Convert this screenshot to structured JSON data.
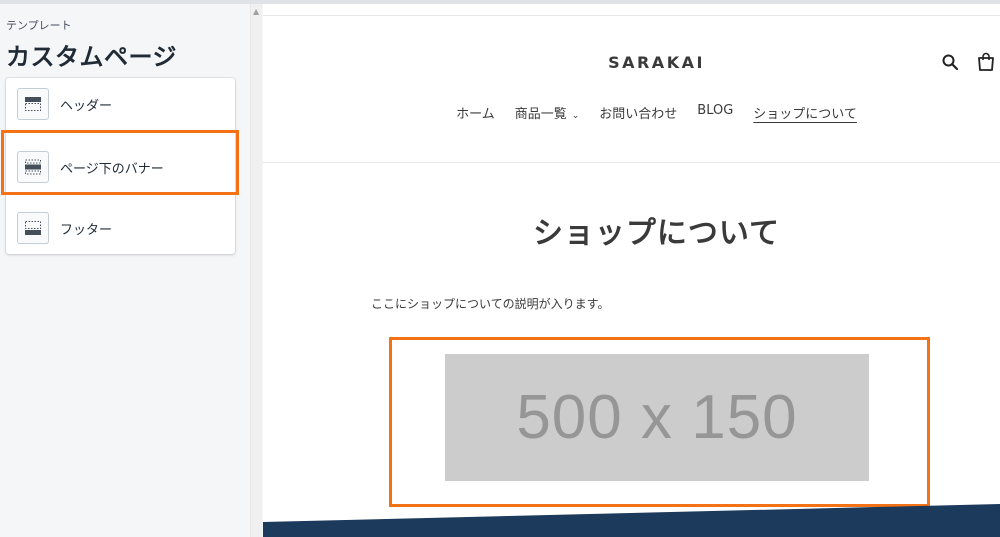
{
  "sidebar": {
    "eyebrow": "テンプレート",
    "title": "カスタムページ",
    "items": [
      {
        "label": "ヘッダー",
        "icon": "header-section-icon"
      },
      {
        "label": "ページ下のバナー",
        "icon": "banner-section-icon"
      },
      {
        "label": "フッター",
        "icon": "footer-section-icon"
      }
    ]
  },
  "preview": {
    "logo": "SARAKAI",
    "nav": [
      {
        "label": "ホーム"
      },
      {
        "label": "商品一覧",
        "has_dropdown": true
      },
      {
        "label": "お問い合わせ"
      },
      {
        "label": "BLOG"
      },
      {
        "label": "ショップについて",
        "active": true
      }
    ],
    "page_heading": "ショップについて",
    "description": "ここにショップについての説明が入ります。",
    "banner_placeholder": "500 x 150",
    "icons": [
      "search-icon",
      "cart-icon"
    ]
  },
  "colors": {
    "highlight": "#f47216",
    "footer": "#1b3a5c",
    "placeholder_bg": "#cccccc",
    "placeholder_text": "#969696"
  }
}
